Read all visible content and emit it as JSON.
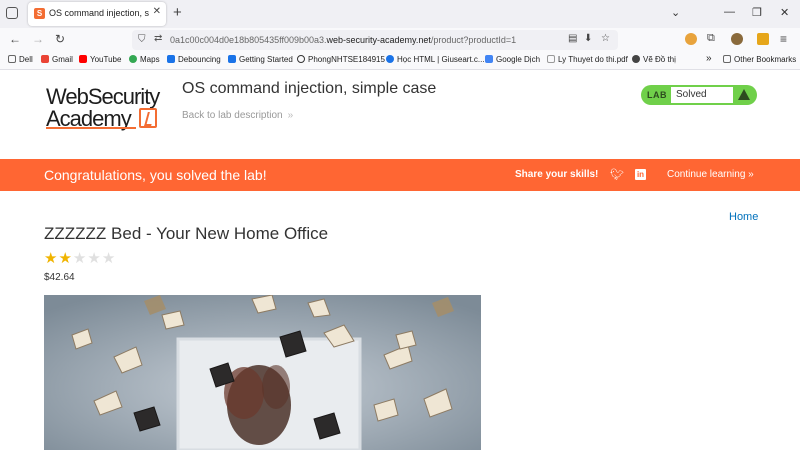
{
  "browser": {
    "tab_title": "OS command injection, simple c",
    "tab_close": "✕",
    "url_prefix": "0a1c00c004d0e18b805435ff009b00a3.",
    "url_host": "web-security-academy.net",
    "url_path": "/product?productId=1",
    "bookmarks": [
      "Dell",
      "Gmail",
      "YouTube",
      "Maps",
      "Debouncing",
      "Getting Started",
      "PhongNHTSE184915",
      "Học HTML | Giuseart.c...",
      "Google Dịch",
      "Ly Thuyet do thi.pdf",
      "Vẽ Đồ thị"
    ],
    "other_bookmarks": "Other Bookmarks"
  },
  "header": {
    "logo_line1": "WebSecurity",
    "logo_line2": "Academy",
    "lab_title": "OS command injection, simple case",
    "back_link": "Back to lab description",
    "lab_label": "LAB",
    "lab_state": "Solved"
  },
  "banner": {
    "message": "Congratulations, you solved the lab!",
    "share": "Share your skills!",
    "continue": "Continue learning"
  },
  "product": {
    "home_link": "Home",
    "title": "ZZZZZZ Bed - Your New Home Office",
    "rating": 2,
    "rating_max": 5,
    "price": "$42.64"
  },
  "colors": {
    "accent": "#ff6633",
    "lab_green": "#70d04a",
    "link_blue": "#0071bc"
  }
}
